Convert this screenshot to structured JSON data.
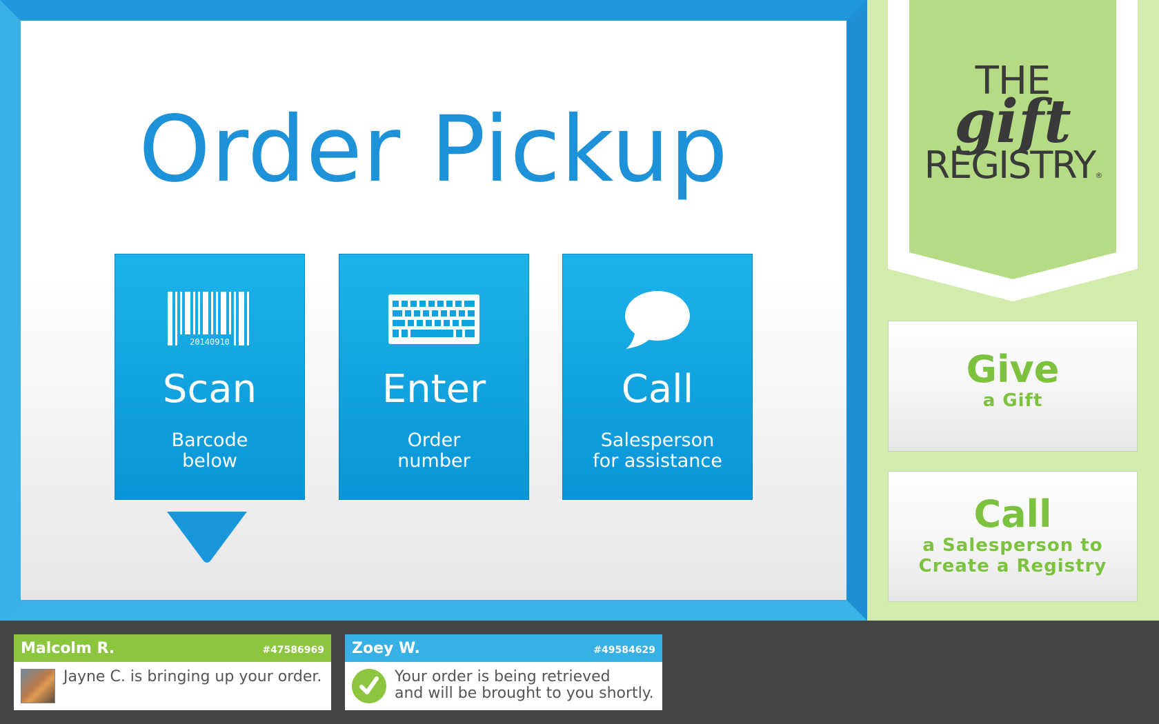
{
  "main": {
    "title": "Order Pickup",
    "tiles": [
      {
        "title": "Scan",
        "subtitle": "Barcode\nbelow",
        "icon": "barcode-icon",
        "barcode_number": "20140910"
      },
      {
        "title": "Enter",
        "subtitle": "Order\nnumber",
        "icon": "keyboard-icon"
      },
      {
        "title": "Call",
        "subtitle": "Salesperson\nfor assistance",
        "icon": "speech-bubble-icon"
      }
    ],
    "arrow_icon": "down-arrow-icon"
  },
  "sidebar": {
    "logo": {
      "line1": "THE",
      "line2": "gift",
      "line3": "REGISTRY",
      "mark": "®"
    },
    "buttons": [
      {
        "big": "Give",
        "small": "a Gift"
      },
      {
        "big": "Call",
        "small": "a Salesperson to\nCreate a Registry"
      }
    ]
  },
  "notifications": [
    {
      "name": "Malcolm R.",
      "order": "#47586969",
      "message": "Jayne C. is bringing up your order.",
      "icon": "avatar"
    },
    {
      "name": "Zoey W.",
      "order": "#49584629",
      "message": "Your order is being retrieved\nand will be brought to you shortly.",
      "icon": "checkmark-icon"
    }
  ],
  "colors": {
    "primary_blue": "#1e92d9",
    "tile_blue": "#0fa5e2",
    "accent_green": "#8cc63f",
    "sidebar_green": "#d1ecac",
    "ribbon_green": "#b5dc84",
    "bottom_bar": "#444444"
  }
}
